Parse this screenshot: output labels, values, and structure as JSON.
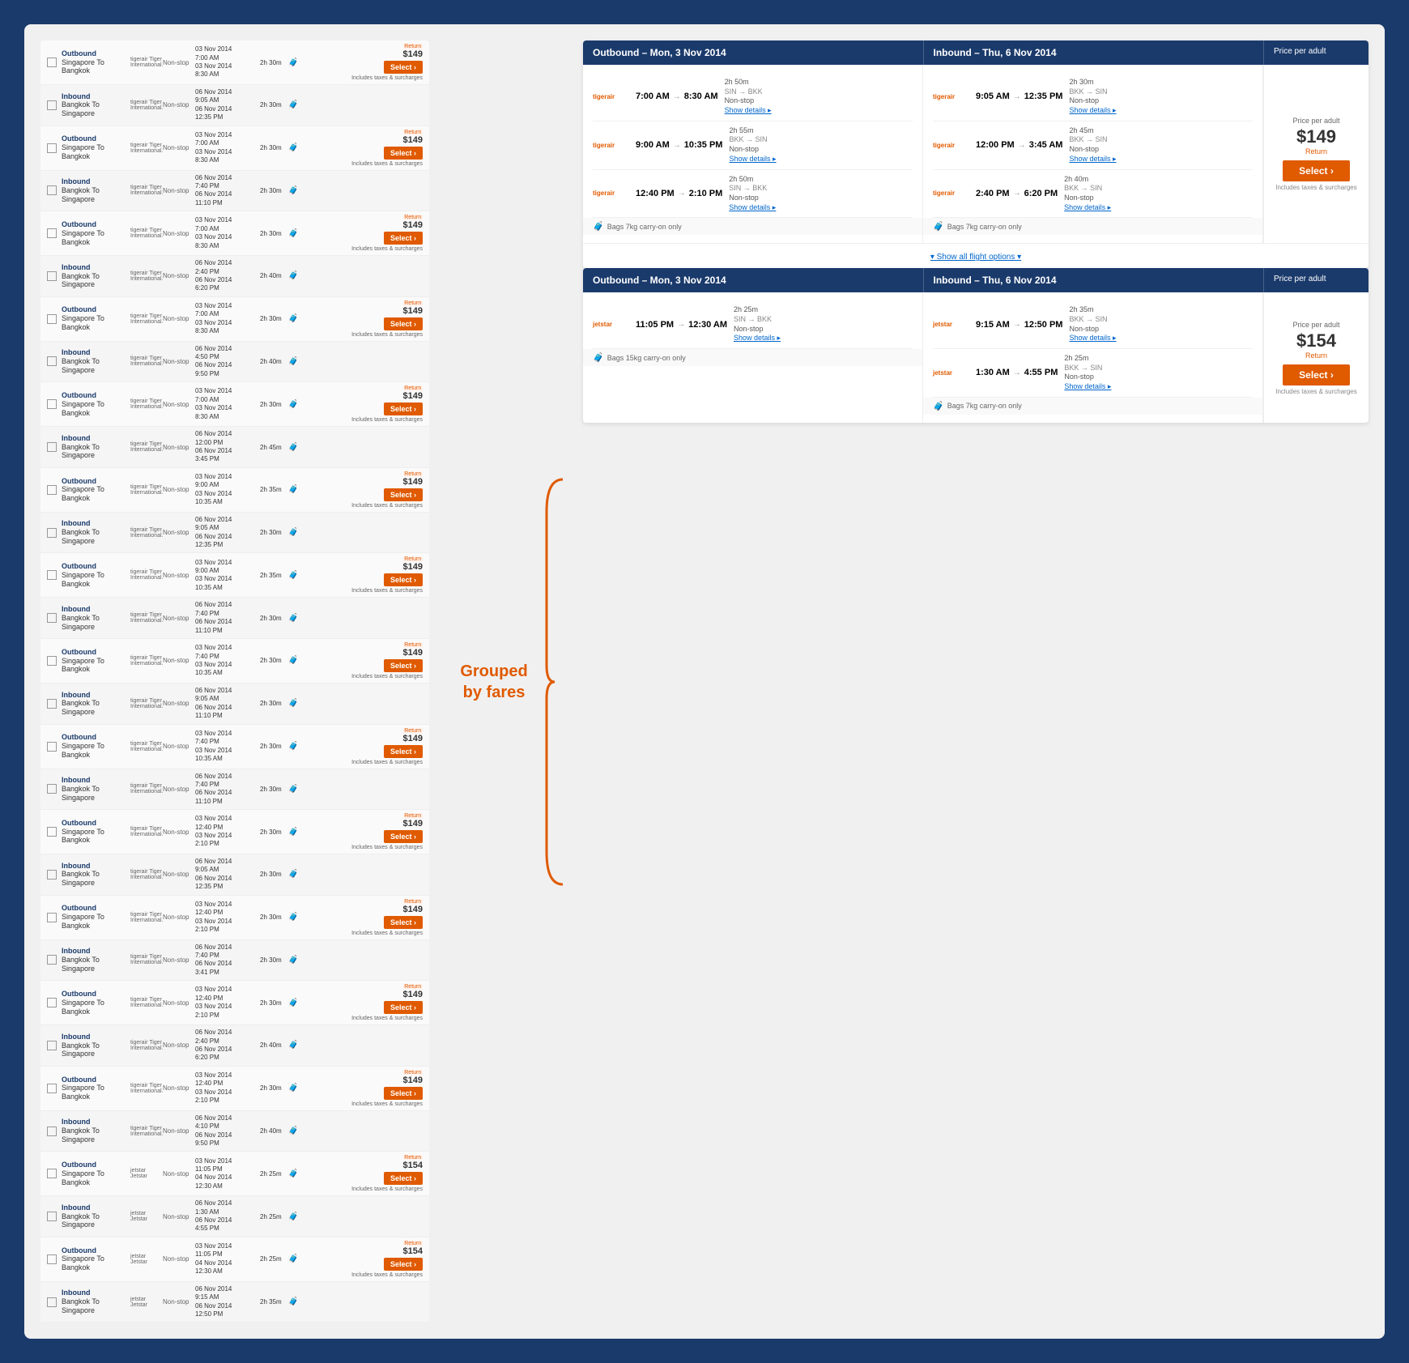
{
  "page": {
    "background_color": "#1a3a6b"
  },
  "grouped_label": {
    "line1": "Grouped",
    "line2": "by fares"
  },
  "flight_list": {
    "rows": [
      {
        "type": "outbound",
        "direction": "Outbound",
        "route": "Singapore To Bangkok",
        "airline": "tigerair Tiger International.",
        "stop": "Non-stop",
        "dep_date": "03 Nov 2014",
        "dep_time": "7:00 AM",
        "arr_date": "03 Nov 2014",
        "arr_time": "8:30 AM",
        "duration": "2h 30m",
        "price": "$149",
        "price_type": "Return",
        "taxes": "Includes taxes & surcharges"
      },
      {
        "type": "inbound",
        "direction": "Inbound",
        "route": "Bangkok To Singapore",
        "airline": "tigerair Tiger International.",
        "stop": "Non-stop",
        "dep_date": "06 Nov 2014",
        "dep_time": "9:05 AM",
        "arr_date": "06 Nov 2014",
        "arr_time": "12:35 PM",
        "duration": "2h 30m",
        "price": "",
        "price_type": "",
        "taxes": ""
      },
      {
        "type": "outbound",
        "direction": "Outbound",
        "route": "Singapore To Bangkok",
        "airline": "tigerair Tiger International.",
        "stop": "Non-stop",
        "dep_date": "03 Nov 2014",
        "dep_time": "7:00 AM",
        "arr_date": "03 Nov 2014",
        "arr_time": "8:30 AM",
        "duration": "2h 30m",
        "price": "$149",
        "price_type": "Return",
        "taxes": "Includes taxes & surcharges"
      },
      {
        "type": "inbound",
        "direction": "Inbound",
        "route": "Bangkok To Singapore",
        "airline": "tigerair Tiger International.",
        "stop": "Non-stop",
        "dep_date": "06 Nov 2014",
        "dep_time": "7:40 PM",
        "arr_date": "06 Nov 2014",
        "arr_time": "11:10 PM",
        "duration": "2h 30m",
        "price": "",
        "price_type": "",
        "taxes": ""
      },
      {
        "type": "outbound",
        "direction": "Outbound",
        "route": "Singapore To Bangkok",
        "airline": "tigerair Tiger International.",
        "stop": "Non-stop",
        "dep_date": "03 Nov 2014",
        "dep_time": "7:00 AM",
        "arr_date": "03 Nov 2014",
        "arr_time": "8:30 AM",
        "duration": "2h 30m",
        "price": "$149",
        "price_type": "Return",
        "taxes": "Includes taxes & surcharges"
      },
      {
        "type": "inbound",
        "direction": "Inbound",
        "route": "Bangkok To Singapore",
        "airline": "tigerair Tiger International.",
        "stop": "Non-stop",
        "dep_date": "06 Nov 2014",
        "dep_time": "2:40 PM",
        "arr_date": "06 Nov 2014",
        "arr_time": "6:20 PM",
        "duration": "2h 40m",
        "price": "",
        "price_type": "",
        "taxes": ""
      },
      {
        "type": "outbound",
        "direction": "Outbound",
        "route": "Singapore To Bangkok",
        "airline": "tigerair Tiger International.",
        "stop": "Non-stop",
        "dep_date": "03 Nov 2014",
        "dep_time": "7:00 AM",
        "arr_date": "03 Nov 2014",
        "arr_time": "8:30 AM",
        "duration": "2h 30m",
        "price": "$149",
        "price_type": "Return",
        "taxes": "Includes taxes & surcharges"
      },
      {
        "type": "inbound",
        "direction": "Inbound",
        "route": "Bangkok To Singapore",
        "airline": "tigerair Tiger International.",
        "stop": "Non-stop",
        "dep_date": "06 Nov 2014",
        "dep_time": "4:50 PM",
        "arr_date": "06 Nov 2014",
        "arr_time": "9:50 PM",
        "duration": "2h 40m",
        "price": "",
        "price_type": "",
        "taxes": ""
      },
      {
        "type": "outbound",
        "direction": "Outbound",
        "route": "Singapore To Bangkok",
        "airline": "tigerair Tiger International.",
        "stop": "Non-stop",
        "dep_date": "03 Nov 2014",
        "dep_time": "7:00 AM",
        "arr_date": "03 Nov 2014",
        "arr_time": "8:30 AM",
        "duration": "2h 30m",
        "price": "$149",
        "price_type": "Return",
        "taxes": "Includes taxes & surcharges"
      },
      {
        "type": "inbound",
        "direction": "Inbound",
        "route": "Bangkok To Singapore",
        "airline": "tigerair Tiger International.",
        "stop": "Non-stop",
        "dep_date": "06 Nov 2014",
        "dep_time": "12:00 PM",
        "arr_date": "06 Nov 2014",
        "arr_time": "3:45 PM",
        "duration": "2h 45m",
        "price": "",
        "price_type": "",
        "taxes": ""
      },
      {
        "type": "outbound",
        "direction": "Outbound",
        "route": "Singapore To Bangkok",
        "airline": "tigerair Tiger International.",
        "stop": "Non-stop",
        "dep_date": "03 Nov 2014",
        "dep_time": "9:00 AM",
        "arr_date": "03 Nov 2014",
        "arr_time": "10:35 AM",
        "duration": "2h 35m",
        "price": "$149",
        "price_type": "Return",
        "taxes": "Includes taxes & surcharges"
      },
      {
        "type": "inbound",
        "direction": "Inbound",
        "route": "Bangkok To Singapore",
        "airline": "tigerair Tiger International.",
        "stop": "Non-stop",
        "dep_date": "06 Nov 2014",
        "dep_time": "9:05 AM",
        "arr_date": "06 Nov 2014",
        "arr_time": "12:35 PM",
        "duration": "2h 30m",
        "price": "",
        "price_type": "",
        "taxes": ""
      },
      {
        "type": "outbound",
        "direction": "Outbound",
        "route": "Singapore To Bangkok",
        "airline": "tigerair Tiger International.",
        "stop": "Non-stop",
        "dep_date": "03 Nov 2014",
        "dep_time": "9:00 AM",
        "arr_date": "03 Nov 2014",
        "arr_time": "10:35 AM",
        "duration": "2h 35m",
        "price": "$149",
        "price_type": "Return",
        "taxes": "Includes taxes & surcharges"
      },
      {
        "type": "inbound",
        "direction": "Inbound",
        "route": "Bangkok To Singapore",
        "airline": "tigerair Tiger International.",
        "stop": "Non-stop",
        "dep_date": "06 Nov 2014",
        "dep_time": "7:40 PM",
        "arr_date": "06 Nov 2014",
        "arr_time": "11:10 PM",
        "duration": "2h 30m",
        "price": "",
        "price_type": "",
        "taxes": ""
      },
      {
        "type": "outbound",
        "direction": "Outbound",
        "route": "Singapore To Bangkok",
        "airline": "tigerair Tiger International.",
        "stop": "Non-stop",
        "dep_date": "03 Nov 2014",
        "dep_time": "7:40 PM",
        "arr_date": "03 Nov 2014",
        "arr_time": "10:35 AM",
        "duration": "2h 30m",
        "price": "$149",
        "price_type": "Return",
        "taxes": "Includes taxes & surcharges"
      },
      {
        "type": "inbound",
        "direction": "Inbound",
        "route": "Bangkok To Singapore",
        "airline": "tigerair Tiger International.",
        "stop": "Non-stop",
        "dep_date": "06 Nov 2014",
        "dep_time": "9:05 AM",
        "arr_date": "06 Nov 2014",
        "arr_time": "11:10 PM",
        "duration": "2h 30m",
        "price": "",
        "price_type": "",
        "taxes": ""
      },
      {
        "type": "outbound",
        "direction": "Outbound",
        "route": "Singapore To Bangkok",
        "airline": "tigerair Tiger International.",
        "stop": "Non-stop",
        "dep_date": "03 Nov 2014",
        "dep_time": "7:40 PM",
        "arr_date": "03 Nov 2014",
        "arr_time": "10:35 AM",
        "duration": "2h 30m",
        "price": "$149",
        "price_type": "Return",
        "taxes": "Includes taxes & surcharges"
      },
      {
        "type": "inbound",
        "direction": "Inbound",
        "route": "Bangkok To Singapore",
        "airline": "tigerair Tiger International.",
        "stop": "Non-stop",
        "dep_date": "06 Nov 2014",
        "dep_time": "7:40 PM",
        "arr_date": "06 Nov 2014",
        "arr_time": "11:10 PM",
        "duration": "2h 30m",
        "price": "",
        "price_type": "",
        "taxes": ""
      },
      {
        "type": "outbound",
        "direction": "Outbound",
        "route": "Singapore To Bangkok",
        "airline": "tigerair Tiger International.",
        "stop": "Non-stop",
        "dep_date": "03 Nov 2014",
        "dep_time": "12:40 PM",
        "arr_date": "03 Nov 2014",
        "arr_time": "2:10 PM",
        "duration": "2h 30m",
        "price": "$149",
        "price_type": "Return",
        "taxes": "Includes taxes & surcharges"
      },
      {
        "type": "inbound",
        "direction": "Inbound",
        "route": "Bangkok To Singapore",
        "airline": "tigerair Tiger International.",
        "stop": "Non-stop",
        "dep_date": "06 Nov 2014",
        "dep_time": "9:05 AM",
        "arr_date": "06 Nov 2014",
        "arr_time": "12:35 PM",
        "duration": "2h 30m",
        "price": "",
        "price_type": "",
        "taxes": ""
      },
      {
        "type": "outbound",
        "direction": "Outbound",
        "route": "Singapore To Bangkok",
        "airline": "tigerair Tiger International.",
        "stop": "Non-stop",
        "dep_date": "03 Nov 2014",
        "dep_time": "12:40 PM",
        "arr_date": "03 Nov 2014",
        "arr_time": "2:10 PM",
        "duration": "2h 30m",
        "price": "$149",
        "price_type": "Return",
        "taxes": "Includes taxes & surcharges"
      },
      {
        "type": "inbound",
        "direction": "Inbound",
        "route": "Bangkok To Singapore",
        "airline": "tigerair Tiger International.",
        "stop": "Non-stop",
        "dep_date": "06 Nov 2014",
        "dep_time": "7:40 PM",
        "arr_date": "06 Nov 2014",
        "arr_time": "3:41 PM",
        "duration": "2h 30m",
        "price": "",
        "price_type": "",
        "taxes": ""
      },
      {
        "type": "outbound",
        "direction": "Outbound",
        "route": "Singapore To Bangkok",
        "airline": "tigerair Tiger International.",
        "stop": "Non-stop",
        "dep_date": "03 Nov 2014",
        "dep_time": "12:40 PM",
        "arr_date": "03 Nov 2014",
        "arr_time": "2:10 PM",
        "duration": "2h 30m",
        "price": "$149",
        "price_type": "Return",
        "taxes": "Includes taxes & surcharges"
      },
      {
        "type": "inbound",
        "direction": "Inbound",
        "route": "Bangkok To Singapore",
        "airline": "tigerair Tiger International.",
        "stop": "Non-stop",
        "dep_date": "06 Nov 2014",
        "dep_time": "2:40 PM",
        "arr_date": "06 Nov 2014",
        "arr_time": "6:20 PM",
        "duration": "2h 40m",
        "price": "",
        "price_type": "",
        "taxes": ""
      },
      {
        "type": "outbound",
        "direction": "Outbound",
        "route": "Singapore To Bangkok",
        "airline": "tigerair Tiger International.",
        "stop": "Non-stop",
        "dep_date": "03 Nov 2014",
        "dep_time": "12:40 PM",
        "arr_date": "03 Nov 2014",
        "arr_time": "2:10 PM",
        "duration": "2h 30m",
        "price": "$149",
        "price_type": "Return",
        "taxes": "Includes taxes & surcharges"
      },
      {
        "type": "inbound",
        "direction": "Inbound",
        "route": "Bangkok To Singapore",
        "airline": "tigerair Tiger International.",
        "stop": "Non-stop",
        "dep_date": "06 Nov 2014",
        "dep_time": "4:10 PM",
        "arr_date": "06 Nov 2014",
        "arr_time": "9:50 PM",
        "duration": "2h 40m",
        "price": "",
        "price_type": "",
        "taxes": ""
      },
      {
        "type": "outbound",
        "direction": "Outbound",
        "route": "Singapore To Bangkok",
        "airline": "jetstar Jetstar",
        "stop": "Non-stop",
        "dep_date": "03 Nov 2014",
        "dep_time": "11:05 PM",
        "arr_date": "04 Nov 2014",
        "arr_time": "12:30 AM",
        "duration": "2h 25m",
        "price": "$154",
        "price_type": "Return",
        "taxes": "Includes taxes & surcharges"
      },
      {
        "type": "inbound",
        "direction": "Inbound",
        "route": "Bangkok To Singapore",
        "airline": "jetstar Jetstar",
        "stop": "Non-stop",
        "dep_date": "06 Nov 2014",
        "dep_time": "1:30 AM",
        "arr_date": "06 Nov 2014",
        "arr_time": "4:55 PM",
        "duration": "2h 25m",
        "price": "",
        "price_type": "",
        "taxes": ""
      },
      {
        "type": "outbound",
        "direction": "Outbound",
        "route": "Singapore To Bangkok",
        "airline": "jetstar Jetstar",
        "stop": "Non-stop",
        "dep_date": "03 Nov 2014",
        "dep_time": "11:05 PM",
        "arr_date": "04 Nov 2014",
        "arr_time": "12:30 AM",
        "duration": "2h 25m",
        "price": "$154",
        "price_type": "Return",
        "taxes": "Includes taxes & surcharges"
      },
      {
        "type": "inbound",
        "direction": "Inbound",
        "route": "Bangkok To Singapore",
        "airline": "jetstar Jetstar",
        "stop": "Non-stop",
        "dep_date": "06 Nov 2014",
        "dep_time": "9:15 AM",
        "arr_date": "06 Nov 2014",
        "arr_time": "12:50 PM",
        "duration": "2h 35m",
        "price": "",
        "price_type": "",
        "taxes": ""
      }
    ]
  },
  "fare_groups": [
    {
      "id": "group1",
      "outbound_header": "Outbound – Mon, 3 Nov 2014",
      "inbound_header": "Inbound – Thu, 6 Nov 2014",
      "price_per_adult": "Price per adult",
      "price": "$149",
      "price_type": "Return",
      "select_label": "Select",
      "taxes_label": "Includes taxes & surcharges",
      "outbound_flights": [
        {
          "airline": "tigerair",
          "dep_time": "7:00 AM",
          "arr_time": "8:30 AM",
          "route": "SIN → BKK",
          "duration": "2h 50m",
          "stop_type": "Non-stop",
          "show_details": "Show details"
        },
        {
          "airline": "tigerair",
          "dep_time": "9:00 AM",
          "arr_time": "10:35 PM",
          "route": "BKK → SIN",
          "duration": "2h 55m",
          "stop_type": "Non-stop",
          "show_details": "Show details"
        },
        {
          "airline": "tigerair",
          "dep_time": "12:40 PM",
          "arr_time": "2:10 PM",
          "route": "SIN → BKK",
          "duration": "2h 50m",
          "stop_type": "Non-stop",
          "show_details": "Show details"
        }
      ],
      "outbound_bags": "Bags 7kg carry-on only",
      "inbound_flights": [
        {
          "airline": "tigerair",
          "dep_time": "9:05 AM",
          "arr_time": "12:35 PM",
          "route": "BKK → SIN",
          "duration": "2h 30m",
          "stop_type": "Non-stop",
          "show_details": "Show details"
        },
        {
          "airline": "tigerair",
          "dep_time": "12:00 PM",
          "arr_time": "3:45 AM",
          "route": "BKK → SIN",
          "duration": "2h 45m",
          "stop_type": "Non-stop",
          "show_details": "Show details"
        },
        {
          "airline": "tigerair",
          "dep_time": "2:40 PM",
          "arr_time": "6:20 PM",
          "route": "BKK → SIN",
          "duration": "2h 40m",
          "stop_type": "Non-stop",
          "show_details": "Show details"
        }
      ],
      "inbound_bags": "Bags 7kg carry-on only",
      "show_all": "▾ Show all flight options ▾"
    },
    {
      "id": "group2",
      "outbound_header": "Outbound – Mon, 3 Nov 2014",
      "inbound_header": "Inbound – Thu, 6 Nov 2014",
      "price_per_adult": "Price per adult",
      "price": "$154",
      "price_type": "Return",
      "select_label": "Select",
      "taxes_label": "Includes taxes & surcharges",
      "outbound_flights": [
        {
          "airline": "jetstar",
          "dep_time": "11:05 PM",
          "arr_time": "12:30 AM",
          "route": "SIN → BKK",
          "duration": "2h 25m",
          "stop_type": "Non-stop",
          "show_details": "Show details"
        }
      ],
      "outbound_bags": "Bags 15kg carry-on only",
      "inbound_flights": [
        {
          "airline": "jetstar",
          "dep_time": "9:15 AM",
          "arr_time": "12:50 PM",
          "route": "BKK → SIN",
          "duration": "2h 35m",
          "stop_type": "Non-stop",
          "show_details": "Show details"
        },
        {
          "airline": "jetstar",
          "dep_time": "1:30 AM",
          "arr_time": "4:55 PM",
          "route": "BKK → SIN",
          "duration": "2h 25m",
          "stop_type": "Non-stop",
          "show_details": "Show details"
        }
      ],
      "inbound_bags": "Bags 7kg carry-on only",
      "show_all": ""
    }
  ]
}
